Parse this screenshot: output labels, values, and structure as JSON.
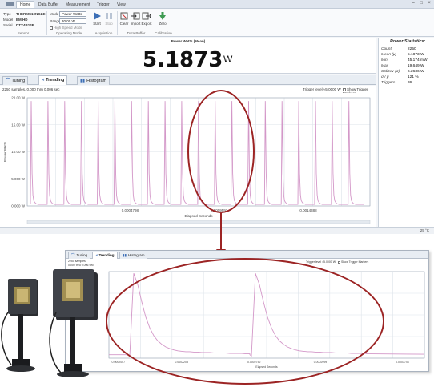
{
  "menu": {
    "tabs": [
      "Home",
      "Data Buffer",
      "Measurement",
      "Trigger",
      "View"
    ],
    "active_tab": "Home"
  },
  "ribbon": {
    "sensor": {
      "type_label": "Type",
      "type_value": "THERMS10NGLE",
      "model_label": "Model",
      "model_value": "EM HD",
      "serial_label": "Serial",
      "serial_value": "DTX4B14B",
      "group_label": "Sensor"
    },
    "operating_mode": {
      "mode_label": "Mode",
      "mode_value": "Power Watts",
      "range_label": "Range",
      "range_value": "30.00 W",
      "high_speed_label": "High Speed Mode",
      "group_label": "Operating Mode"
    },
    "acquisition": {
      "start_label": "Start",
      "stop_label": "Stop",
      "group_label": "Acquisition"
    },
    "data_buffer": {
      "clear_label": "Clear",
      "import_label": "Import",
      "export_label": "Export",
      "group_label": "Data Buffer"
    },
    "calibration": {
      "zero_label": "Zero",
      "group_label": "Calibration"
    }
  },
  "power_display": {
    "title": "Power Watts (Mean)",
    "value": "5.1873",
    "unit": "W"
  },
  "stats": {
    "title": "Power Statistics:",
    "rows": [
      {
        "key": "Count",
        "value": "2250"
      },
      {
        "key": "Mean (μ)",
        "value": "5.1873 W"
      },
      {
        "key": "Min",
        "value": "45.174 mW"
      },
      {
        "key": "Max",
        "value": "19.649 W"
      },
      {
        "key": "StdDev (σ)",
        "value": "6.2636 W"
      },
      {
        "key": "σ / μ",
        "value": "121 %"
      },
      {
        "key": "Triggers",
        "value": "36"
      }
    ]
  },
  "view_tabs": [
    "Tuning",
    "Trending",
    "Histogram"
  ],
  "active_view": "Trending",
  "trend": {
    "samples_text": "2250 samples, 0.000 thru 0.006 sec",
    "trigger_text": "Trigger level ≈5.0000 W",
    "markers_text": "Show Trigger Markers"
  },
  "status": {
    "text": "25 °C"
  },
  "zoom": {
    "samples_text": "2250 samples\n0.000 thru 0.006 sec",
    "trigger_text": "Trigger level ≈5.0000 W",
    "markers_text": "Show Trigger Markers"
  },
  "colors": {
    "trace": "#d397c8",
    "callout": "#9c2424",
    "grid": "#dde3ea",
    "accent": "#3d6fb6"
  },
  "chart_data": [
    {
      "type": "line",
      "title": "",
      "xlabel": "Elapsed Seconds",
      "ylabel": "Power Watts",
      "y_ticks": [
        "0.000 W",
        "5.000 W",
        "10.00 W",
        "15.00 W",
        "20.00 W"
      ],
      "x_ticks": [
        "0.0004798",
        "0.0009592",
        "0.0014388"
      ],
      "ylim": [
        0,
        20
      ],
      "grid": true,
      "series": [
        {
          "pulse_count": 20,
          "x": [
            0,
            2,
            4,
            6,
            8,
            10,
            12,
            14,
            16,
            18,
            20,
            22,
            24,
            26,
            28,
            30,
            32,
            34,
            36,
            38
          ],
          "values": [
            0.3,
            19.4,
            6,
            2,
            1,
            0.7,
            0.5,
            0.4,
            0.35,
            0.3,
            0.3,
            0.3,
            0.3,
            0.3,
            0.3,
            0.3,
            0.3,
            0.3,
            0.3,
            0.3
          ]
        }
      ]
    },
    {
      "type": "line",
      "title": "",
      "xlabel": "Elapsed Seconds",
      "ylabel": "",
      "x_ticks": [
        "0.0002007",
        "0.0002203",
        "0.0002752",
        "0.0002999",
        "0.0003746"
      ],
      "grid": true,
      "series": [
        {
          "x": [
            0,
            1,
            2,
            3,
            4,
            5,
            6,
            7,
            8,
            9,
            10,
            11,
            12,
            13,
            14,
            15,
            16,
            17,
            18,
            19,
            20,
            21,
            22,
            23,
            24,
            25,
            26,
            27,
            28,
            29,
            30
          ],
          "values": [
            0.5,
            19.6,
            17,
            13,
            9.5,
            7,
            5.2,
            4,
            3.2,
            2.6,
            2.2,
            1.9,
            1.7,
            1.6,
            1.5,
            1.5,
            1.4,
            1.4,
            1.3,
            1.3,
            1.3,
            1.2,
            1.2,
            1.2,
            1.2,
            1.1,
            1.1,
            1.1,
            1.1,
            1.0,
            1.0
          ]
        }
      ]
    }
  ]
}
